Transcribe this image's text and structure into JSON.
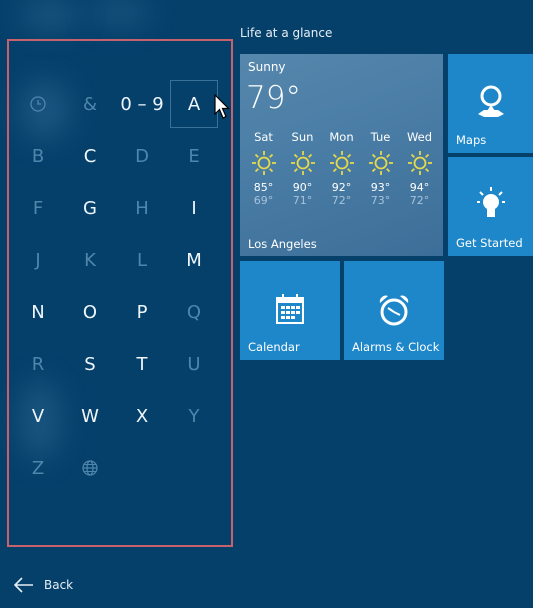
{
  "jump_list": {
    "letters": [
      {
        "label": "recent-clock",
        "icon": "clock-icon",
        "active": false
      },
      {
        "label": "&",
        "active": false
      },
      {
        "label": "0 – 9",
        "active": true
      },
      {
        "label": "A",
        "active": true,
        "hovered": true
      },
      {
        "label": "B",
        "active": false
      },
      {
        "label": "C",
        "active": true
      },
      {
        "label": "D",
        "active": false
      },
      {
        "label": "E",
        "active": false
      },
      {
        "label": "F",
        "active": false
      },
      {
        "label": "G",
        "active": true
      },
      {
        "label": "H",
        "active": false
      },
      {
        "label": "I",
        "active": true
      },
      {
        "label": "J",
        "active": false
      },
      {
        "label": "K",
        "active": false
      },
      {
        "label": "L",
        "active": false
      },
      {
        "label": "M",
        "active": true
      },
      {
        "label": "N",
        "active": true
      },
      {
        "label": "O",
        "active": true
      },
      {
        "label": "P",
        "active": true
      },
      {
        "label": "Q",
        "active": false
      },
      {
        "label": "R",
        "active": false
      },
      {
        "label": "S",
        "active": true
      },
      {
        "label": "T",
        "active": true
      },
      {
        "label": "U",
        "active": false
      },
      {
        "label": "V",
        "active": true
      },
      {
        "label": "W",
        "active": true
      },
      {
        "label": "X",
        "active": true
      },
      {
        "label": "Y",
        "active": false
      },
      {
        "label": "Z",
        "active": false
      },
      {
        "label": "globe",
        "icon": "globe-icon",
        "active": false
      }
    ]
  },
  "tiles_section": {
    "title": "Life at a glance"
  },
  "weather": {
    "condition": "Sunny",
    "current_temp": "79°",
    "location": "Los Angeles",
    "forecast": [
      {
        "day": "Sat",
        "high": "85°",
        "low": "69°",
        "icon": "sun-icon"
      },
      {
        "day": "Sun",
        "high": "90°",
        "low": "71°",
        "icon": "sun-icon"
      },
      {
        "day": "Mon",
        "high": "92°",
        "low": "72°",
        "icon": "sun-icon"
      },
      {
        "day": "Tue",
        "high": "93°",
        "low": "73°",
        "icon": "sun-icon"
      },
      {
        "day": "Wed",
        "high": "94°",
        "low": "72°",
        "icon": "sun-icon"
      }
    ]
  },
  "tiles": {
    "maps": "Maps",
    "get_started": "Get Started",
    "calendar": "Calendar",
    "alarms": "Alarms & Clock"
  },
  "footer": {
    "back_label": "Back"
  },
  "colors": {
    "background": "#05406b",
    "tile": "#1e87c9",
    "highlight_border": "#c8616b",
    "sun": "#e6d94a"
  }
}
